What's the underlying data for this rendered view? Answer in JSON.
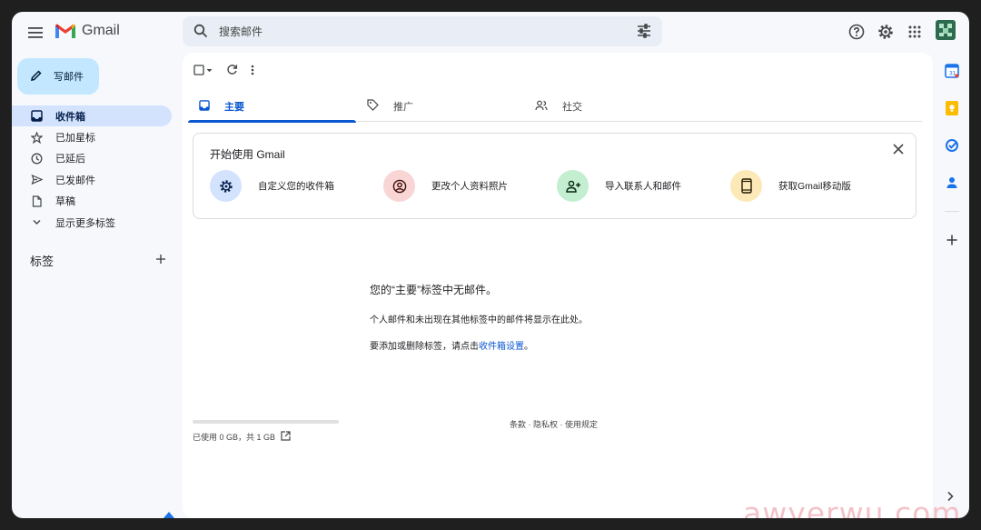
{
  "header": {
    "app_name": "Gmail",
    "search_placeholder": "搜索邮件",
    "icons": [
      "menu-icon",
      "search-icon",
      "tune-icon",
      "help-icon",
      "settings-icon",
      "apps-icon"
    ]
  },
  "sidebar": {
    "compose_label": "写邮件",
    "items": [
      {
        "label": "收件箱",
        "icon": "inbox-icon",
        "active": true
      },
      {
        "label": "已加星标",
        "icon": "star-icon"
      },
      {
        "label": "已延后",
        "icon": "clock-icon"
      },
      {
        "label": "已发邮件",
        "icon": "send-icon"
      },
      {
        "label": "草稿",
        "icon": "draft-icon"
      },
      {
        "label": "显示更多标签",
        "icon": "chevron-down-icon"
      }
    ],
    "labels_title": "标签"
  },
  "tabs": [
    {
      "label": "主要",
      "icon": "inbox-icon",
      "active": true
    },
    {
      "label": "推广",
      "icon": "tag-icon"
    },
    {
      "label": "社交",
      "icon": "people-icon"
    }
  ],
  "setup_card": {
    "title": "开始使用 Gmail",
    "items": [
      {
        "label": "自定义您的收件箱",
        "icon": "settings-icon",
        "color": "#d3e3fd"
      },
      {
        "label": "更改个人资料照片",
        "icon": "account-icon",
        "color": "#f9d5d5"
      },
      {
        "label": "导入联系人和邮件",
        "icon": "person-add-icon",
        "color": "#c4eed0"
      },
      {
        "label": "获取Gmail移动版",
        "icon": "phone-icon",
        "color": "#fde9b8"
      }
    ]
  },
  "empty_state": {
    "title": "您的“主要”标签中无邮件。",
    "line1": "个人邮件和未出现在其他标签中的邮件将显示在此处。",
    "line2_prefix": "要添加或删除标签，请点击",
    "line2_link": "收件箱设置",
    "line2_suffix": "。"
  },
  "storage": {
    "text": "已使用 0 GB，共 1 GB",
    "used_fraction": 0.0
  },
  "footer": {
    "links": "条款 · 隐私权 · 使用规定"
  },
  "watermark": "awyerwu.com",
  "colors": {
    "accent": "#0b57d0",
    "compose_bg": "#c2e7ff",
    "active_nav": "#d3e3fd"
  }
}
